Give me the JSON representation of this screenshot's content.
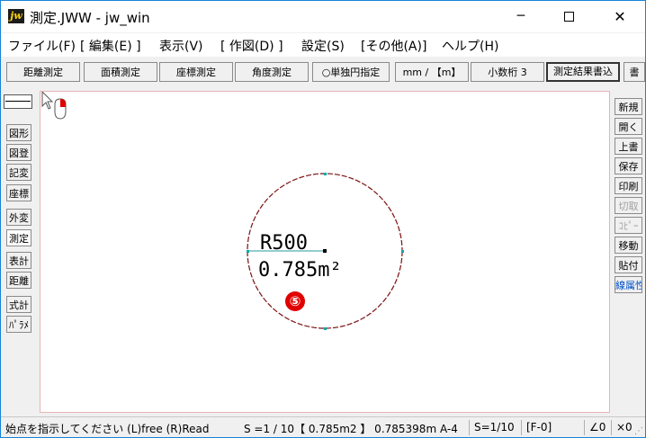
{
  "window": {
    "title": "測定.JWW - jw_win",
    "app_icon_text": "jw",
    "minimize_glyph": "─",
    "close_glyph": "✕"
  },
  "menu": [
    "ファイル(F)",
    "[ 編集(E) ]",
    "表示(V)",
    "[ 作図(D) ]",
    "設定(S)",
    "[その他(A)]",
    "ヘルプ(H)"
  ],
  "toolbar": {
    "buttons": [
      "距離測定",
      "面積測定",
      "座標測定",
      "角度測定",
      "○単独円指定",
      "mm / 【m】",
      "小数桁 3",
      "測定結果書込",
      "書"
    ]
  },
  "left_panel": {
    "buttons": [
      "図形",
      "図登",
      "記変",
      "座標",
      "外変",
      "測定",
      "表計",
      "距離",
      "式計",
      "ﾊﾟﾗﾒ"
    ],
    "active": "測定"
  },
  "right_panel": {
    "buttons": [
      "新規",
      "開く",
      "上書",
      "保存",
      "印刷",
      "切取",
      "ｺﾋﾟｰ",
      "移動",
      "貼付",
      "線属性"
    ],
    "disabled": [
      "切取",
      "ｺﾋﾟｰ"
    ]
  },
  "canvas": {
    "radius_text": "R500",
    "area_text": "0.785m²",
    "step_badge": "⑤",
    "circle_color": "#7a1010",
    "cursor_icon": "mouse-right-button-icon"
  },
  "status": {
    "instruction": "始点を指示してください (L)free (R)Read",
    "scale": "S =1 / 10【 0.785m2 】 0.785398m A-4",
    "scale2": "S=1/10",
    "mode": "[F-0]",
    "angle": "∠0",
    "zoom": "×0"
  }
}
